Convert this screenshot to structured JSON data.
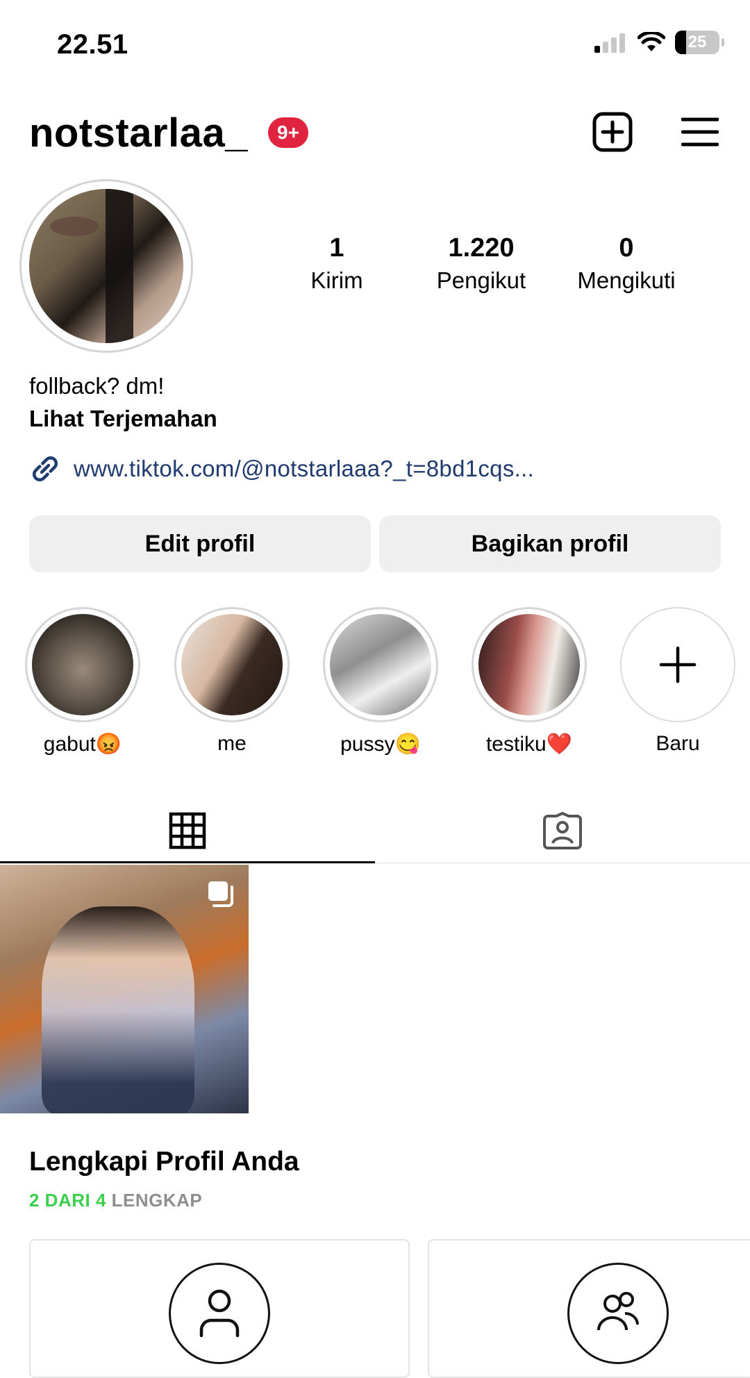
{
  "status_bar": {
    "time": "22.51",
    "battery": "25"
  },
  "header": {
    "username": "notstarlaa_",
    "notification_badge": "9+"
  },
  "stats": [
    {
      "num": "1",
      "label": "Kirim"
    },
    {
      "num": "1.220",
      "label": "Pengikut"
    },
    {
      "num": "0",
      "label": "Mengikuti"
    }
  ],
  "bio": {
    "text": "follback? dm!",
    "translate": "Lihat Terjemahan",
    "link": "www.tiktok.com/@notstarlaaa?_t=8bd1cqs..."
  },
  "buttons": {
    "edit": "Edit profil",
    "share": "Bagikan profil"
  },
  "highlights": [
    {
      "label": "gabut😡"
    },
    {
      "label": "me"
    },
    {
      "label": "pussy😋"
    },
    {
      "label": "testiku❤️"
    },
    {
      "label": "Baru"
    }
  ],
  "complete_profile": {
    "title": "Lengkapi Profil Anda",
    "progress_done": "2 DARI 4",
    "progress_word": "LENGKAP",
    "steps_done": 2,
    "steps_total": 4
  },
  "colors": {
    "badge": "#e0243f",
    "link": "#1f3a6e",
    "progress": "#3ccf4e",
    "button_bg": "#efefef"
  }
}
